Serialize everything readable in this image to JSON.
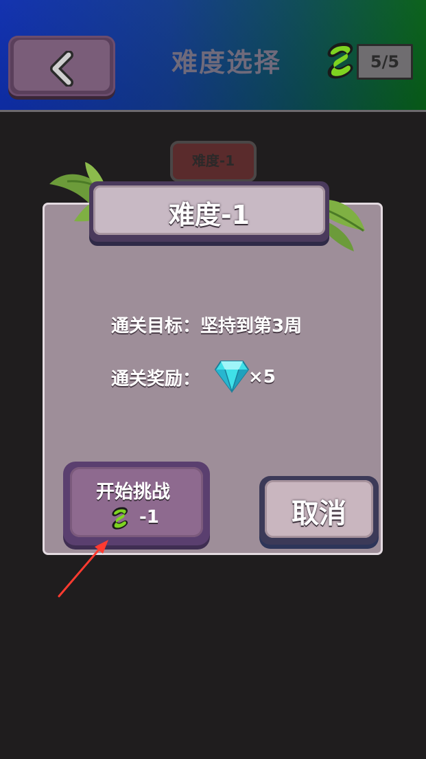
{
  "header": {
    "title": "难度选择",
    "energy": "5/5"
  },
  "level_tab": {
    "label": "难度-1"
  },
  "dialog": {
    "title": "难度-1",
    "goal": "通关目标：坚持到第3周",
    "reward_label": "通关奖励：",
    "reward_quantity": "×5",
    "start_button": {
      "label": "开始挑战",
      "cost": "-1"
    },
    "cancel_button": {
      "label": "取消"
    }
  },
  "colors": {
    "energy_green": "#7ed321",
    "diamond_cyan": "#3fe0e8",
    "annotation_red": "#ff3b30"
  },
  "icons": [
    "back-chevron-icon",
    "energy-bolt-icon",
    "diamond-icon",
    "annotation-arrow"
  ]
}
